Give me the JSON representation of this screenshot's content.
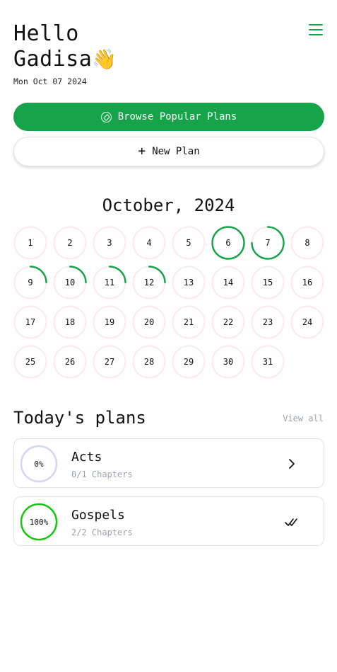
{
  "header": {
    "greeting_line1": "Hello",
    "greeting_line2": "Gadisa",
    "wave_emoji": "👋",
    "date": "Mon Oct 07 2024"
  },
  "menu": {
    "icon": "hamburger-menu-icon",
    "color": "#16a34a"
  },
  "actions": {
    "browse_label": "Browse Popular Plans",
    "browse_icon": "compass-icon",
    "new_plan_label": "New Plan",
    "new_plan_icon": "plus-icon"
  },
  "calendar": {
    "month_title": "October, 2024",
    "days": [
      {
        "day": 1,
        "progress": 0
      },
      {
        "day": 2,
        "progress": 0
      },
      {
        "day": 3,
        "progress": 0
      },
      {
        "day": 4,
        "progress": 0
      },
      {
        "day": 5,
        "progress": 0
      },
      {
        "day": 6,
        "progress": 1
      },
      {
        "day": 7,
        "progress": 0.75
      },
      {
        "day": 8,
        "progress": 0
      },
      {
        "day": 9,
        "progress": 0.25
      },
      {
        "day": 10,
        "progress": 0.25
      },
      {
        "day": 11,
        "progress": 0.25
      },
      {
        "day": 12,
        "progress": 0.25
      },
      {
        "day": 13,
        "progress": 0
      },
      {
        "day": 14,
        "progress": 0
      },
      {
        "day": 15,
        "progress": 0
      },
      {
        "day": 16,
        "progress": 0
      },
      {
        "day": 17,
        "progress": 0
      },
      {
        "day": 18,
        "progress": 0
      },
      {
        "day": 19,
        "progress": 0
      },
      {
        "day": 20,
        "progress": 0
      },
      {
        "day": 21,
        "progress": 0
      },
      {
        "day": 22,
        "progress": 0
      },
      {
        "day": 23,
        "progress": 0
      },
      {
        "day": 24,
        "progress": 0
      },
      {
        "day": 25,
        "progress": 0
      },
      {
        "day": 26,
        "progress": 0
      },
      {
        "day": 27,
        "progress": 0
      },
      {
        "day": 28,
        "progress": 0
      },
      {
        "day": 29,
        "progress": 0
      },
      {
        "day": 30,
        "progress": 0
      },
      {
        "day": 31,
        "progress": 0
      }
    ],
    "colors": {
      "track": "#fde8ea",
      "progress": "#16a34a"
    }
  },
  "plans_section": {
    "title": "Today's plans",
    "view_all": "View all"
  },
  "plans": [
    {
      "percent_label": "0%",
      "progress": 0,
      "name": "Acts",
      "chapters": "0/1 Chapters",
      "ring_color": "#d4d4f7",
      "trailing_icon": "chevron-right-icon"
    },
    {
      "percent_label": "100%",
      "progress": 1,
      "name": "Gospels",
      "chapters": "2/2 Chapters",
      "ring_color": "#16c60c",
      "trailing_icon": "double-check-icon"
    }
  ]
}
